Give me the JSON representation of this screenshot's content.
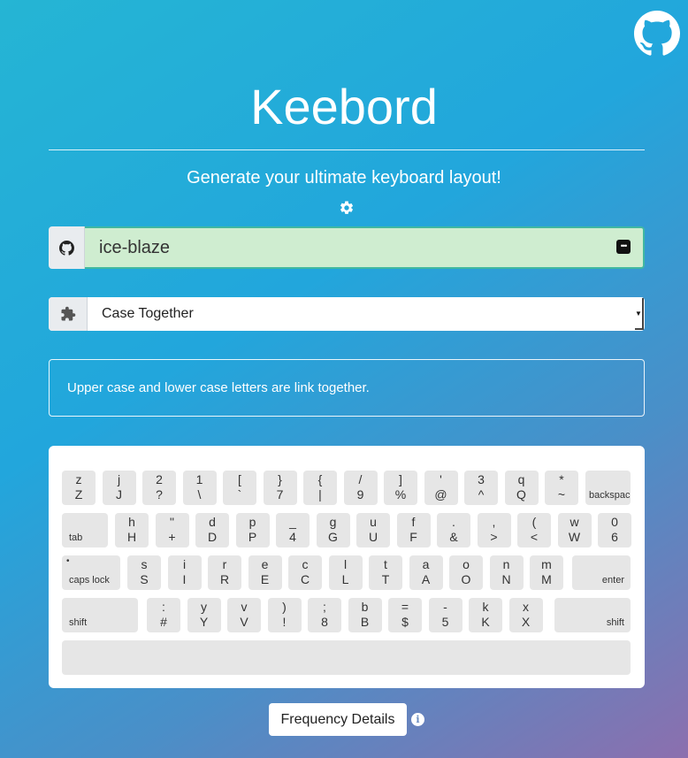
{
  "header": {
    "title": "Keebord",
    "subtitle": "Generate your ultimate keyboard layout!",
    "github_icon": "github-icon",
    "settings_icon": "gear-icon"
  },
  "user_input": {
    "value": "ice-blaze",
    "addon_icon": "github-icon"
  },
  "layout_select": {
    "selected": "Case Together",
    "addon_icon": "puzzle-icon"
  },
  "description": "Upper case and lower case letters are link together.",
  "keyboard": {
    "row1": [
      {
        "t": "z",
        "b": "Z"
      },
      {
        "t": "j",
        "b": "J"
      },
      {
        "t": "2",
        "b": "?"
      },
      {
        "t": "1",
        "b": "\\"
      },
      {
        "t": "[",
        "b": "`"
      },
      {
        "t": "}",
        "b": "7"
      },
      {
        "t": "{",
        "b": "|"
      },
      {
        "t": "/",
        "b": "9"
      },
      {
        "t": "]",
        "b": "%"
      },
      {
        "t": "'",
        "b": "@"
      },
      {
        "t": "3",
        "b": "^"
      },
      {
        "t": "q",
        "b": "Q"
      },
      {
        "t": "*",
        "b": "~"
      }
    ],
    "backspace": "backspace",
    "tab": "tab",
    "row2": [
      {
        "t": "h",
        "b": "H"
      },
      {
        "t": "\"",
        "b": "+"
      },
      {
        "t": "d",
        "b": "D"
      },
      {
        "t": "p",
        "b": "P"
      },
      {
        "t": "_",
        "b": "4"
      },
      {
        "t": "g",
        "b": "G"
      },
      {
        "t": "u",
        "b": "U"
      },
      {
        "t": "f",
        "b": "F"
      },
      {
        "t": ".",
        "b": "&"
      },
      {
        "t": ",",
        "b": ">"
      },
      {
        "t": "(",
        "b": "<"
      },
      {
        "t": "w",
        "b": "W"
      },
      {
        "t": "0",
        "b": "6"
      }
    ],
    "caps": "caps lock",
    "caps_dot": "•",
    "row3": [
      {
        "t": "s",
        "b": "S"
      },
      {
        "t": "i",
        "b": "I"
      },
      {
        "t": "r",
        "b": "R"
      },
      {
        "t": "e",
        "b": "E"
      },
      {
        "t": "c",
        "b": "C"
      },
      {
        "t": "l",
        "b": "L"
      },
      {
        "t": "t",
        "b": "T"
      },
      {
        "t": "a",
        "b": "A"
      },
      {
        "t": "o",
        "b": "O"
      },
      {
        "t": "n",
        "b": "N"
      },
      {
        "t": "m",
        "b": "M"
      }
    ],
    "enter": "enter",
    "shift_left": "shift",
    "row4": [
      {
        "t": ":",
        "b": "#"
      },
      {
        "t": "y",
        "b": "Y"
      },
      {
        "t": "v",
        "b": "V"
      },
      {
        "t": ")",
        "b": "!"
      },
      {
        "t": ";",
        "b": "8"
      },
      {
        "t": "b",
        "b": "B"
      },
      {
        "t": "=",
        "b": "$"
      },
      {
        "t": "-",
        "b": "5"
      },
      {
        "t": "k",
        "b": "K"
      },
      {
        "t": "x",
        "b": "X"
      }
    ],
    "shift_right": "shift"
  },
  "footer": {
    "frequency_button": "Frequency Details",
    "info_icon": "info-icon",
    "info_glyph": "i"
  }
}
